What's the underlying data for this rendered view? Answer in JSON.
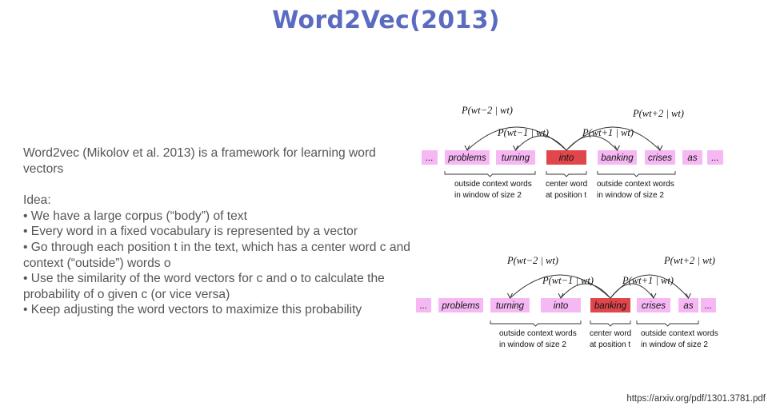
{
  "title": "Word2Vec(2013)",
  "body": {
    "intro": "Word2vec (Mikolov et al. 2013) is a framework for learning word vectors",
    "idea_label": "Idea:",
    "bullets": [
      "• We have a large corpus (“body”) of text",
      "• Every word in a fixed vocabulary is represented by a vector",
      "• Go through each position t in the text, which has a center word c and context (“outside”) words o",
      "• Use the similarity of the word vectors for c and o to calculate the probability of o given c (or vice versa)",
      "• Keep adjusting the word vectors to maximize this probability"
    ]
  },
  "diagrams": [
    {
      "words": [
        "...",
        "problems",
        "turning",
        "into",
        "banking",
        "crises",
        "as",
        "..."
      ],
      "center_index": 3,
      "probs": [
        "P(wt−2 | wt)",
        "P(wt−1 | wt)",
        "P(wt+1 | wt)",
        "P(wt+2 | wt)"
      ],
      "left_label": [
        "outside context words",
        "in window of size 2"
      ],
      "center_label": [
        "center word",
        "at position t"
      ],
      "right_label": [
        "outside context words",
        "in window of size 2"
      ]
    },
    {
      "words": [
        "...",
        "problems",
        "turning",
        "into",
        "banking",
        "crises",
        "as",
        "..."
      ],
      "center_index": 4,
      "probs": [
        "P(wt−2 | wt)",
        "P(wt−1 | wt)",
        "P(wt+1 | wt)",
        "P(wt+2 | wt)"
      ],
      "left_label": [
        "outside context words",
        "in window of size 2"
      ],
      "center_label": [
        "center word",
        "at position t"
      ],
      "right_label": [
        "outside context words",
        "in window of size 2"
      ]
    }
  ],
  "colors": {
    "title": "#5b6bc0",
    "context_box": "#f6b8f3",
    "center_box": "#e0474c",
    "text": "#555555"
  },
  "footer": {
    "url": "https://arxiv.org/pdf/1301.3781.pdf"
  }
}
